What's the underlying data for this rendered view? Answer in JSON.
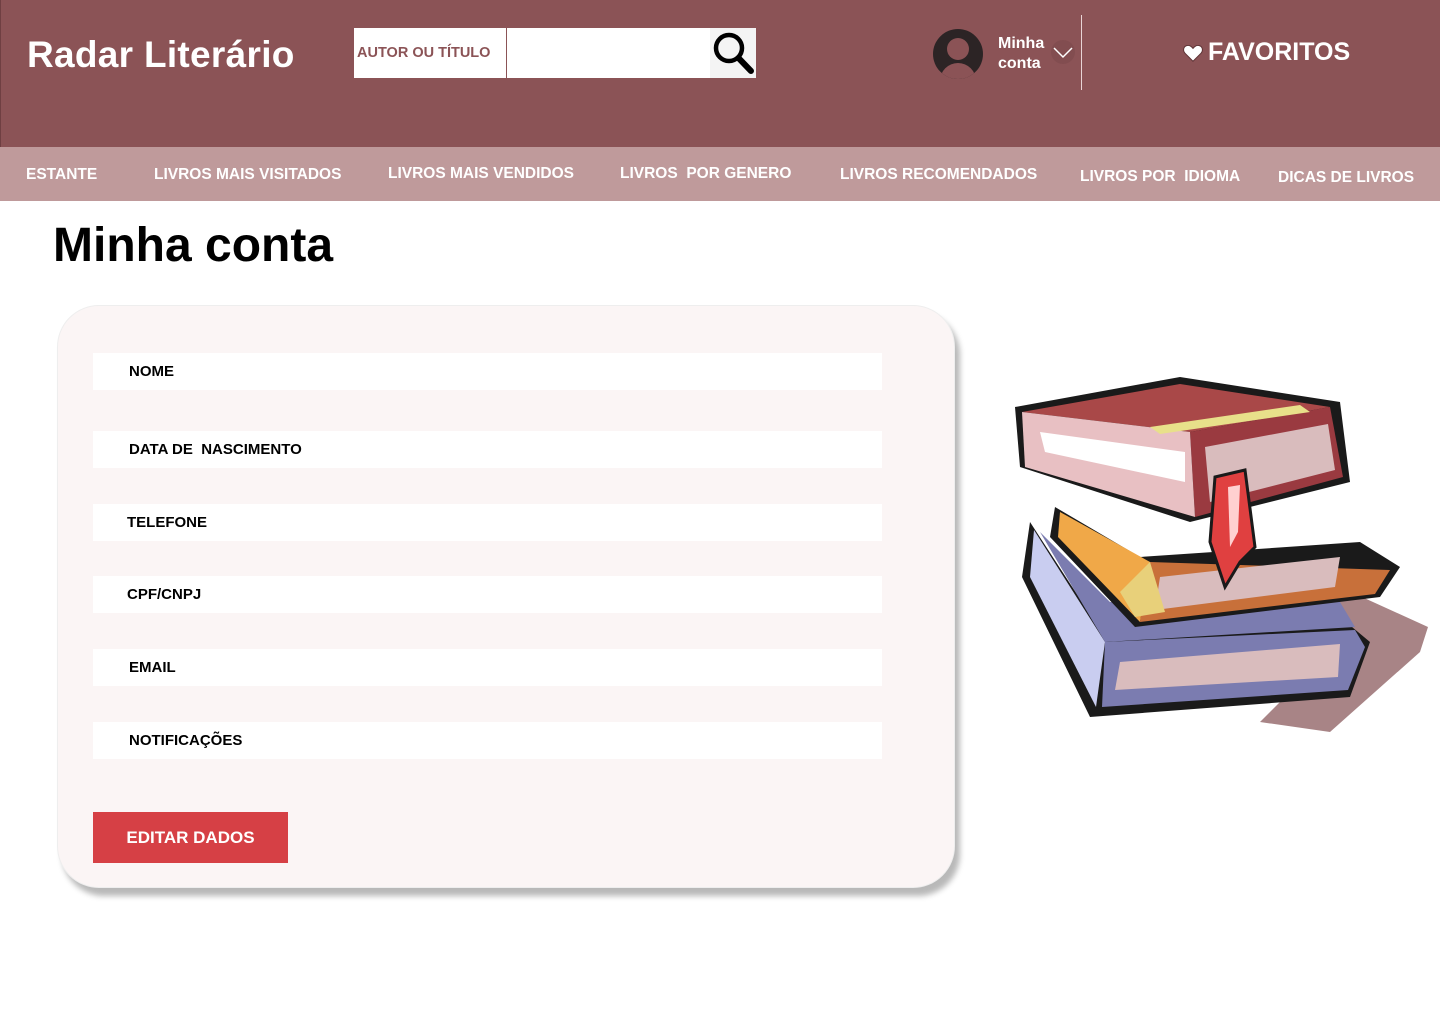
{
  "header": {
    "brand": "Radar Literário",
    "search": {
      "label": "AUTOR OU TÍTULO",
      "value": "",
      "placeholder": ""
    },
    "account": {
      "label": "Minha conta"
    },
    "favorites": {
      "label": "FAVORITOS"
    }
  },
  "nav": {
    "items": [
      {
        "label": "ESTANTE"
      },
      {
        "label": "LIVROS MAIS VISITADOS"
      },
      {
        "label": "LIVROS MAIS VENDIDOS"
      },
      {
        "label": "LIVROS  POR GENERO"
      },
      {
        "label": "LIVROS RECOMENDADOS"
      },
      {
        "label": "LIVROS POR  IDIOMA"
      },
      {
        "label": "DICAS DE LIVROS"
      }
    ]
  },
  "main": {
    "title": "Minha conta",
    "fields": [
      {
        "label": "NOME"
      },
      {
        "label": "DATA DE  NASCIMENTO"
      },
      {
        "label": "TELEFONE"
      },
      {
        "label": "CPF/CNPJ"
      },
      {
        "label": "EMAIL"
      },
      {
        "label": "NOTIFICAÇÕES"
      }
    ],
    "edit_button": "EDITAR DADOS"
  },
  "colors": {
    "header_bg": "#8b5356",
    "nav_bg": "#bf9a9b",
    "card_bg": "#fbf5f5",
    "button_bg": "#d64045"
  },
  "icons": [
    "search-icon",
    "avatar-icon",
    "chevron-down-icon",
    "heart-icon",
    "books-illustration"
  ]
}
